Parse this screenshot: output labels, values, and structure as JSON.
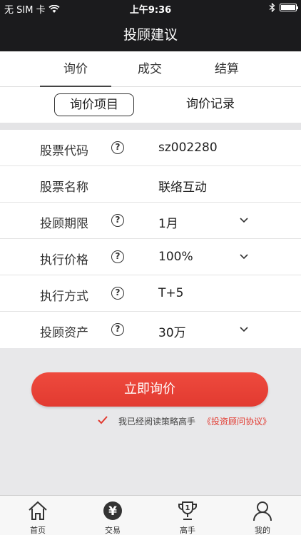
{
  "status": {
    "carrier": "无 SIM 卡",
    "time": "上午9:36",
    "battery_level": 1.0
  },
  "nav": {
    "title": "投顾建议"
  },
  "tabs": [
    {
      "label": "询价",
      "active": true
    },
    {
      "label": "成交",
      "active": false
    },
    {
      "label": "结算",
      "active": false
    }
  ],
  "subtabs": [
    {
      "label": "询价项目",
      "active": true
    },
    {
      "label": "询价记录",
      "active": false
    }
  ],
  "form": {
    "rows": [
      {
        "label": "股票代码",
        "help": "?",
        "value": "sz002280",
        "has_dropdown": false
      },
      {
        "label": "股票名称",
        "help": "",
        "value": "联络互动",
        "has_dropdown": false
      },
      {
        "label": "投顾期限",
        "help": "?",
        "value": "1月",
        "has_dropdown": true
      },
      {
        "label": "执行价格",
        "help": "?",
        "value": "100%",
        "has_dropdown": true
      },
      {
        "label": "执行方式",
        "help": "?",
        "value": "T+5",
        "has_dropdown": false
      },
      {
        "label": "投顾资产",
        "help": "?",
        "value": "30万",
        "has_dropdown": true
      }
    ]
  },
  "cta": {
    "label": "立即询价"
  },
  "agreement": {
    "checked": true,
    "text": "我已经阅读策略高手",
    "link": "《投资顾问协议》"
  },
  "tabbar": [
    {
      "label": "首页",
      "icon": "home-icon"
    },
    {
      "label": "交易",
      "icon": "yen-icon",
      "glyph": "¥"
    },
    {
      "label": "高手",
      "icon": "trophy-icon",
      "glyph": "1"
    },
    {
      "label": "我的",
      "icon": "user-icon"
    }
  ],
  "colors": {
    "accent": "#e23a30",
    "dark_bar": "#1b1b1d"
  }
}
